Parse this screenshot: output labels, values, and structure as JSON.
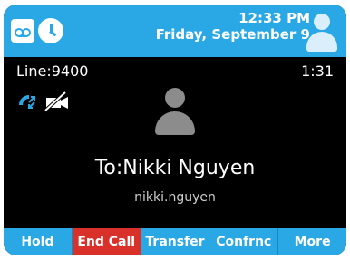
{
  "colors": {
    "accent": "#2aa8e6",
    "danger": "#d9302a"
  },
  "status": {
    "icons": [
      "voicemail-icon",
      "clock-icon",
      "contact-avatar-icon"
    ],
    "time": "12:33 PM",
    "date": "Friday, September 9"
  },
  "call": {
    "line": "Line:9400",
    "duration": "1:31",
    "icons": [
      "hd-call-icon",
      "video-off-icon",
      "contact-avatar-icon"
    ],
    "to": "To:Nikki Nguyen",
    "contact_id": "nikki.nguyen"
  },
  "softkeys": [
    {
      "label": "Hold"
    },
    {
      "label": "End Call"
    },
    {
      "label": "Transfer"
    },
    {
      "label": "Confrnc"
    },
    {
      "label": "More"
    }
  ]
}
